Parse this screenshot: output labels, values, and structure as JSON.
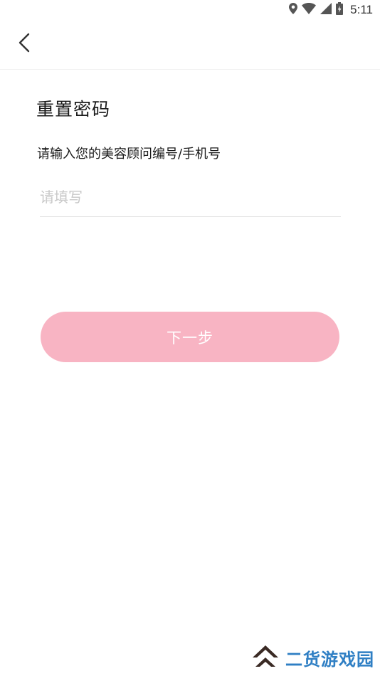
{
  "status_bar": {
    "time": "5:11",
    "icons": [
      "location-icon",
      "wifi-icon",
      "signal-icon",
      "battery-icon"
    ]
  },
  "nav": {
    "back_icon": "chevron-left-icon"
  },
  "form": {
    "title": "重置密码",
    "label": "请输入您的美容顾问编号/手机号",
    "input_placeholder": "请填写",
    "input_value": "",
    "next_label": "下一步"
  },
  "colors": {
    "button_bg": "#f8b4c3",
    "button_text": "#ffffff",
    "placeholder": "#c8c8c8",
    "watermark_text": "#2f7fc4",
    "watermark_logo": "#3a2a24"
  },
  "watermark": {
    "text": "二货游戏园",
    "logo_icon": "double-chevron-up-icon"
  }
}
